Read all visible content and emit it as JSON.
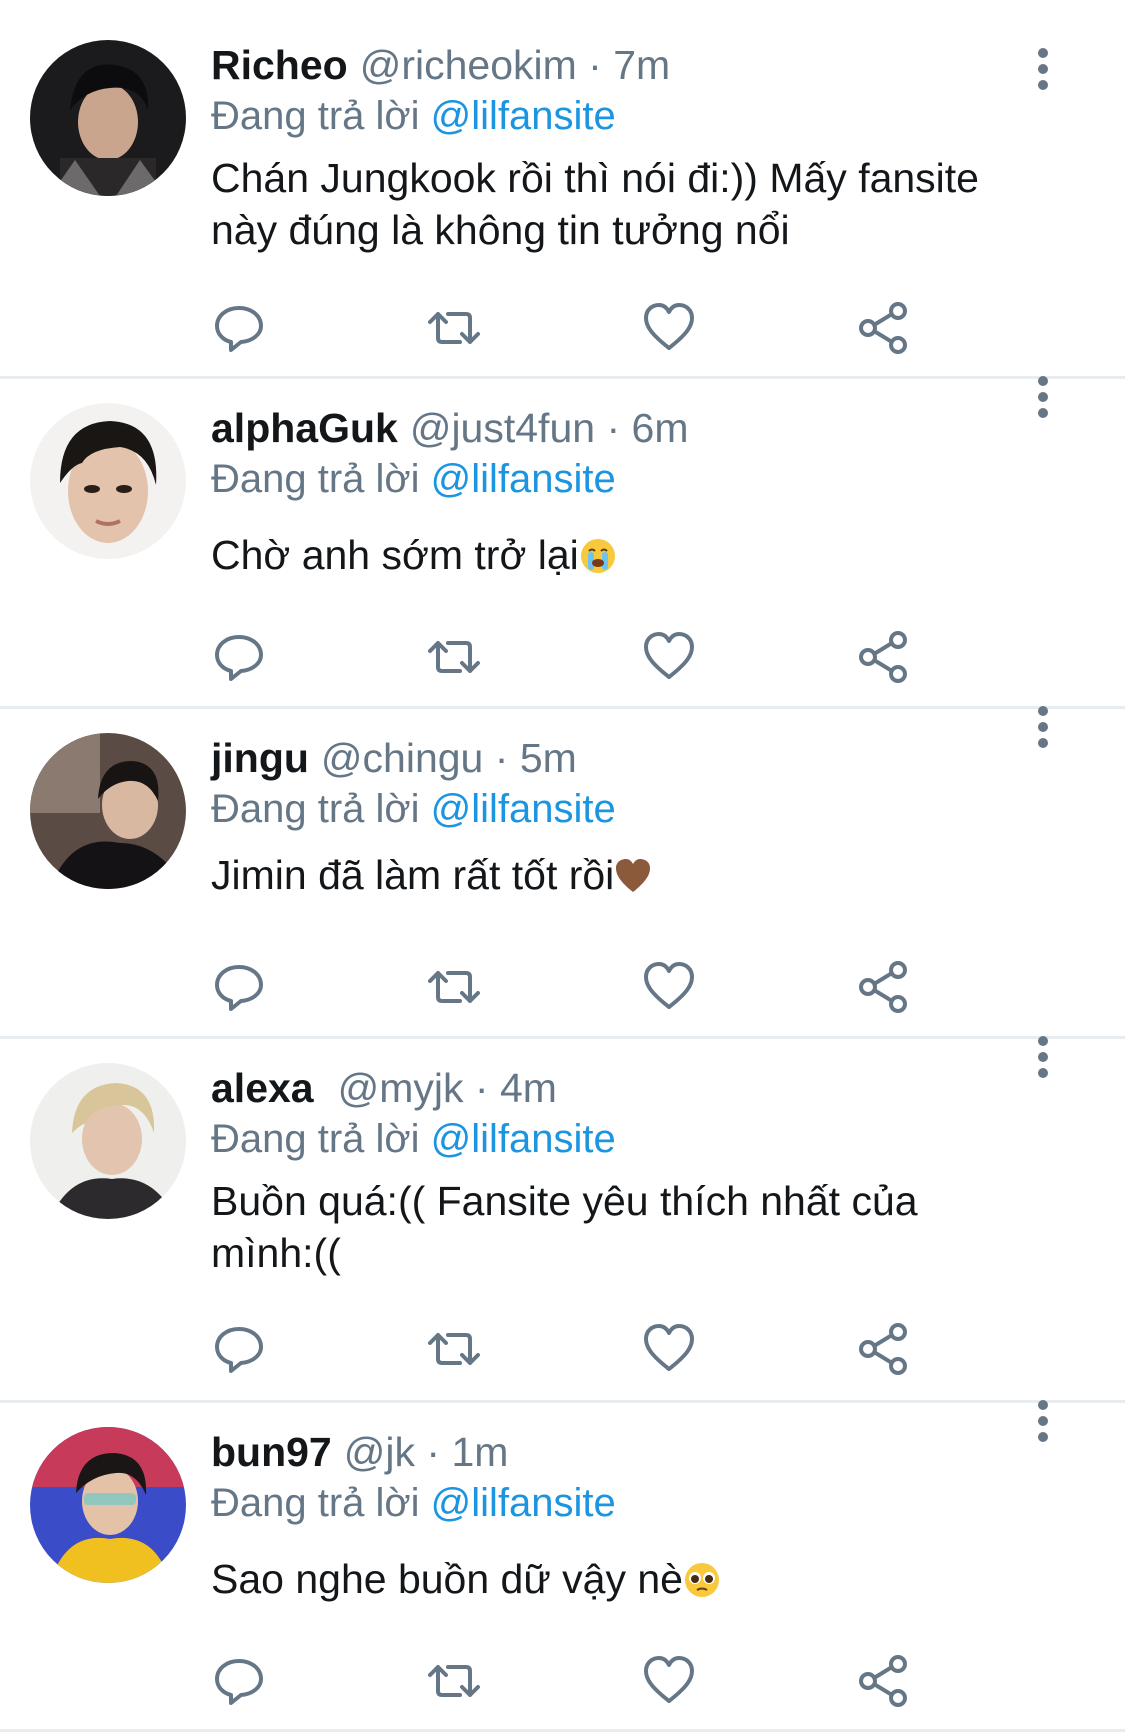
{
  "tweets": [
    {
      "name": "Richeo",
      "handle": "@richeokim",
      "time": "7m",
      "reply_prefix": "Đang trả lời",
      "reply_to": "@lilfansite",
      "text_line1": "Chán Jungkook rồi thì nói đi:)) Mấy fansite",
      "text_line2": "này đúng là không tin tưởng nổi"
    },
    {
      "name": "alphaGuk",
      "handle": "@just4fun",
      "time": "6m",
      "reply_prefix": "Đang trả lời",
      "reply_to": "@lilfansite",
      "text": "Chờ anh sớm trở lại",
      "emoji": "loudly-crying-face"
    },
    {
      "name": "jingu",
      "handle": "@chingu",
      "time": "5m",
      "reply_prefix": "Đang trả lời",
      "reply_to": "@lilfansite",
      "text": "Jimin đã làm rất tốt rồi",
      "emoji": "brown-heart"
    },
    {
      "name": "alexa",
      "handle": "@myjk",
      "time": "4m",
      "reply_prefix": "Đang trả lời",
      "reply_to": "@lilfansite",
      "text_line1": "Buồn quá:(( Fansite yêu thích nhất của",
      "text_line2": "mình:(("
    },
    {
      "name": "bun97",
      "handle": "@jk",
      "time": "1m",
      "reply_prefix": "Đang trả lời",
      "reply_to": "@lilfansite",
      "text": "Sao nghe buồn dữ vậy nè",
      "emoji": "pleading-face"
    }
  ],
  "icons": {
    "reply": "reply-icon",
    "retweet": "retweet-icon",
    "like": "heart-icon",
    "share": "share-icon",
    "more": "more-vertical-icon"
  },
  "colors": {
    "text": "#14171a",
    "secondary": "#657786",
    "mention": "#1b95e0",
    "icon": "#657786",
    "divider": "#e6ecf0"
  },
  "meta": {
    "separator": "·"
  }
}
